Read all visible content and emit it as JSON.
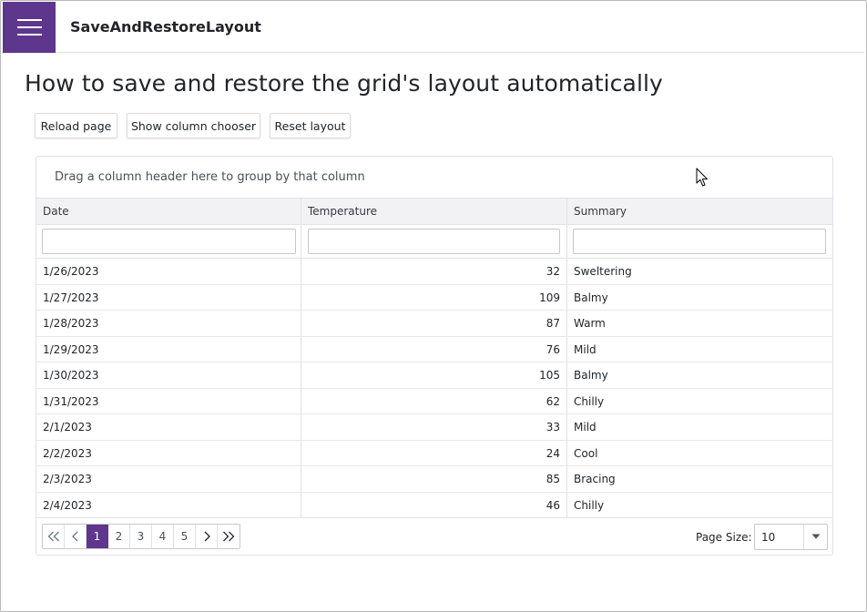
{
  "app": {
    "title": "SaveAndRestoreLayout"
  },
  "page": {
    "title": "How to save and restore the grid's layout automatically"
  },
  "toolbar": {
    "reload_label": "Reload page",
    "column_chooser_label": "Show column chooser",
    "reset_label": "Reset layout"
  },
  "grid": {
    "group_panel_text": "Drag a column header here to group by that column",
    "columns": [
      "Date",
      "Temperature",
      "Summary"
    ],
    "filters": [
      "",
      "",
      ""
    ],
    "rows": [
      {
        "date": "1/26/2023",
        "temperature": "32",
        "summary": "Sweltering"
      },
      {
        "date": "1/27/2023",
        "temperature": "109",
        "summary": "Balmy"
      },
      {
        "date": "1/28/2023",
        "temperature": "87",
        "summary": "Warm"
      },
      {
        "date": "1/29/2023",
        "temperature": "76",
        "summary": "Mild"
      },
      {
        "date": "1/30/2023",
        "temperature": "105",
        "summary": "Balmy"
      },
      {
        "date": "1/31/2023",
        "temperature": "62",
        "summary": "Chilly"
      },
      {
        "date": "2/1/2023",
        "temperature": "33",
        "summary": "Mild"
      },
      {
        "date": "2/2/2023",
        "temperature": "24",
        "summary": "Cool"
      },
      {
        "date": "2/3/2023",
        "temperature": "85",
        "summary": "Bracing"
      },
      {
        "date": "2/4/2023",
        "temperature": "46",
        "summary": "Chilly"
      }
    ],
    "pager": {
      "pages": [
        "1",
        "2",
        "3",
        "4",
        "5"
      ],
      "active_page": "1",
      "page_size_label": "Page Size:",
      "page_size_value": "10"
    }
  },
  "colors": {
    "accent": "#5f368d",
    "header_bg": "#f2f2f5",
    "border": "#dee2e6"
  },
  "icons": [
    "menu-icon",
    "first-page-icon",
    "prev-page-icon",
    "next-page-icon",
    "last-page-icon",
    "dropdown-arrow-icon",
    "mouse-cursor-icon"
  ]
}
